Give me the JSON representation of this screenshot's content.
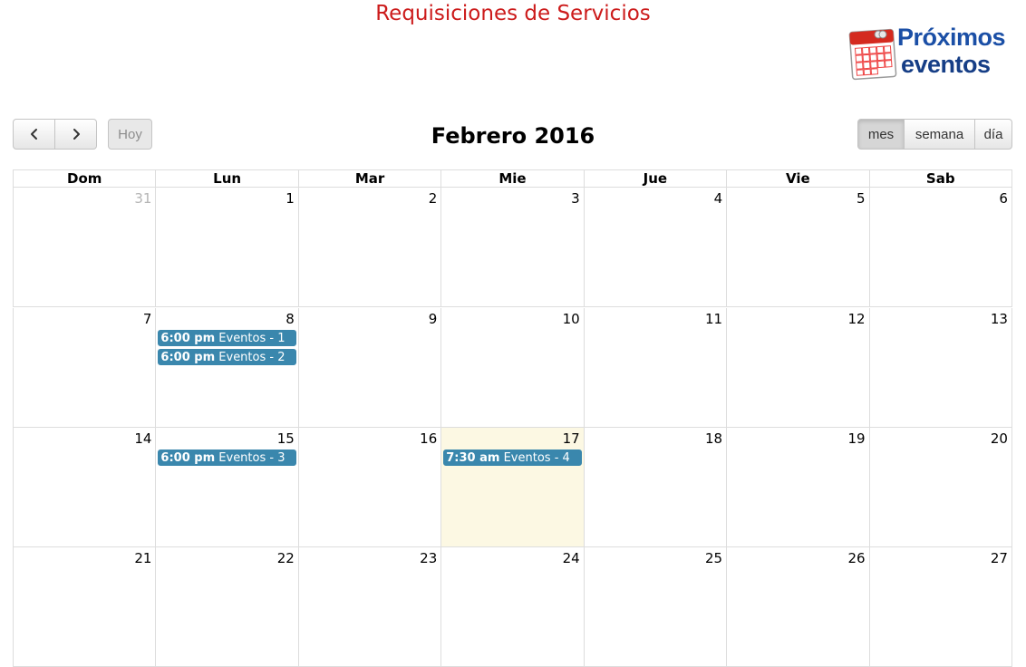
{
  "header": {
    "title": "Requisiciones de Servicios",
    "logo": {
      "line1": "Próximos",
      "line2": "eventos",
      "icon": "calendar-icon"
    }
  },
  "toolbar": {
    "prev_icon": "chevron-left-icon",
    "next_icon": "chevron-right-icon",
    "today_label": "Hoy",
    "title": "Febrero 2016",
    "views": {
      "month": "mes",
      "week": "semana",
      "day": "día"
    },
    "active_view": "mes"
  },
  "calendar": {
    "weekdays": [
      "Dom",
      "Lun",
      "Mar",
      "Mie",
      "Jue",
      "Vie",
      "Sab"
    ],
    "weeks": [
      {
        "days": [
          {
            "num": "31",
            "other": true,
            "events": []
          },
          {
            "num": "1",
            "events": []
          },
          {
            "num": "2",
            "events": []
          },
          {
            "num": "3",
            "events": []
          },
          {
            "num": "4",
            "events": []
          },
          {
            "num": "5",
            "events": []
          },
          {
            "num": "6",
            "events": []
          }
        ]
      },
      {
        "days": [
          {
            "num": "7",
            "events": []
          },
          {
            "num": "8",
            "events": [
              {
                "time": "6:00 pm",
                "title": "Eventos - 1"
              },
              {
                "time": "6:00 pm",
                "title": "Eventos - 2"
              }
            ]
          },
          {
            "num": "9",
            "events": []
          },
          {
            "num": "10",
            "events": []
          },
          {
            "num": "11",
            "events": []
          },
          {
            "num": "12",
            "events": []
          },
          {
            "num": "13",
            "events": []
          }
        ]
      },
      {
        "days": [
          {
            "num": "14",
            "events": []
          },
          {
            "num": "15",
            "events": [
              {
                "time": "6:00 pm",
                "title": "Eventos - 3"
              }
            ]
          },
          {
            "num": "16",
            "events": []
          },
          {
            "num": "17",
            "today": true,
            "events": [
              {
                "time": "7:30 am",
                "title": "Eventos - 4"
              }
            ]
          },
          {
            "num": "18",
            "events": []
          },
          {
            "num": "19",
            "events": []
          },
          {
            "num": "20",
            "events": []
          }
        ]
      },
      {
        "days": [
          {
            "num": "21",
            "events": []
          },
          {
            "num": "22",
            "events": []
          },
          {
            "num": "23",
            "events": []
          },
          {
            "num": "24",
            "events": []
          },
          {
            "num": "25",
            "events": []
          },
          {
            "num": "26",
            "events": []
          },
          {
            "num": "27",
            "events": []
          }
        ]
      }
    ]
  },
  "colors": {
    "title": "#cc1b1b",
    "event_bg": "#3a87ad",
    "today_bg": "#fcf8e3",
    "logo_blue": "#1b4fa6"
  }
}
